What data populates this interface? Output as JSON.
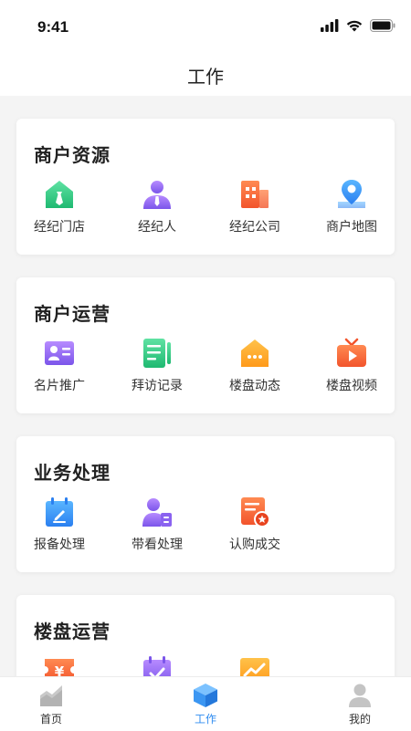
{
  "status_bar": {
    "time": "9:41"
  },
  "header": {
    "title": "工作"
  },
  "sections": [
    {
      "title": "商户资源",
      "items": [
        {
          "label": "经纪门店",
          "icon": "store-icon"
        },
        {
          "label": "经纪人",
          "icon": "agent-icon"
        },
        {
          "label": "经纪公司",
          "icon": "company-building-icon"
        },
        {
          "label": "商户地图",
          "icon": "map-pin-icon"
        }
      ]
    },
    {
      "title": "商户运营",
      "items": [
        {
          "label": "名片推广",
          "icon": "business-card-icon"
        },
        {
          "label": "拜访记录",
          "icon": "visit-record-icon"
        },
        {
          "label": "楼盘动态",
          "icon": "property-news-icon"
        },
        {
          "label": "楼盘视频",
          "icon": "video-icon"
        }
      ]
    },
    {
      "title": "业务处理",
      "items": [
        {
          "label": "报备处理",
          "icon": "report-icon"
        },
        {
          "label": "带看处理",
          "icon": "viewing-icon"
        },
        {
          "label": "认购成交",
          "icon": "subscription-deal-icon"
        }
      ]
    },
    {
      "title": "楼盘运营",
      "items": [
        {
          "label": "",
          "icon": "price-tag-icon"
        },
        {
          "label": "",
          "icon": "calendar-check-icon"
        },
        {
          "label": "",
          "icon": "trend-chart-icon"
        }
      ]
    }
  ],
  "tab_bar": [
    {
      "label": "首页",
      "icon": "home-chart-icon",
      "active": false
    },
    {
      "label": "工作",
      "icon": "work-cube-icon",
      "active": true
    },
    {
      "label": "我的",
      "icon": "profile-icon",
      "active": false
    }
  ],
  "colors": {
    "accent": "#2f8cf0",
    "background": "#f4f4f4",
    "card": "#ffffff"
  }
}
